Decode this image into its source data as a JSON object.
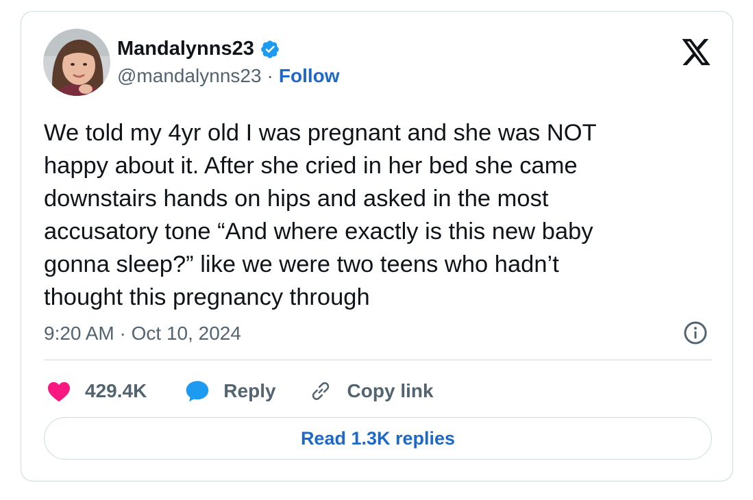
{
  "author": {
    "display_name": "Mandalynns23",
    "handle": "@mandalynns23",
    "separator": "·",
    "follow_label": "Follow",
    "verified_icon": "verified-badge-icon",
    "avatar_icon": "avatar-photo"
  },
  "platform_icon": "x-logo-icon",
  "tweet": {
    "text": "We told my 4yr old I was pregnant and she was NOT\nhappy about it. After she cried in her bed she came\ndownstairs hands on hips and asked in the most\naccusatory tone “And where exactly is this new baby\ngonna sleep?” like we were two teens who hadn’t\nthought this pregnancy through",
    "timestamp": "9:20 AM · Oct 10, 2024",
    "info_icon": "info-icon"
  },
  "actions": {
    "like_count": "429.4K",
    "like_icon": "heart-icon",
    "reply_label": "Reply",
    "reply_icon": "speech-bubble-icon",
    "copy_label": "Copy link",
    "copy_icon": "link-icon"
  },
  "read_replies_label": "Read 1.3K replies",
  "colors": {
    "accent_blue": "#1d68c9",
    "heart_pink": "#f91880",
    "reply_blue": "#1d9bf0",
    "text_primary": "#0f1419",
    "text_secondary": "#536471",
    "border": "#cfd9de"
  }
}
